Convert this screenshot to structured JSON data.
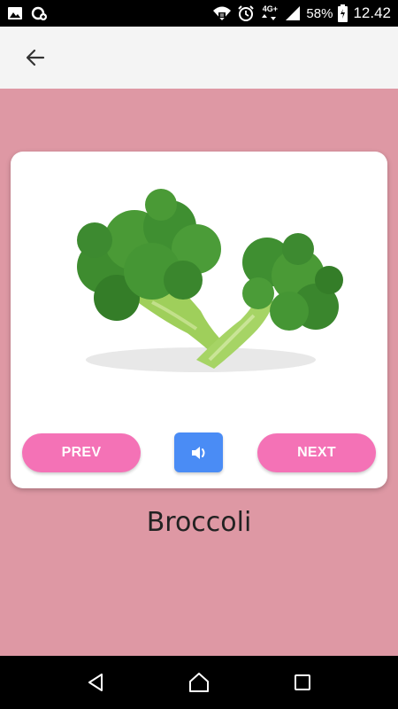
{
  "status_bar": {
    "network_type": "4G+",
    "battery_percent": "58%",
    "time": "12.42",
    "icons": [
      "image-icon",
      "data-saver-icon",
      "wifi-icon",
      "alarm-icon",
      "network-arrows-icon",
      "signal-icon",
      "battery-charging-icon"
    ]
  },
  "app_bar": {
    "back_icon": "arrow-left-icon"
  },
  "flashcard": {
    "image": "broccoli-image",
    "prev_label": "PREV",
    "next_label": "NEXT",
    "sound_icon": "speaker-icon",
    "item_name": "Broccoli"
  },
  "colors": {
    "background": "#de98a4",
    "button_pink": "#f472b6",
    "button_blue": "#4a8cf5",
    "app_bar": "#f4f4f4"
  },
  "nav_bar": {
    "icons": [
      "back-triangle-icon",
      "home-icon",
      "recents-icon"
    ]
  }
}
